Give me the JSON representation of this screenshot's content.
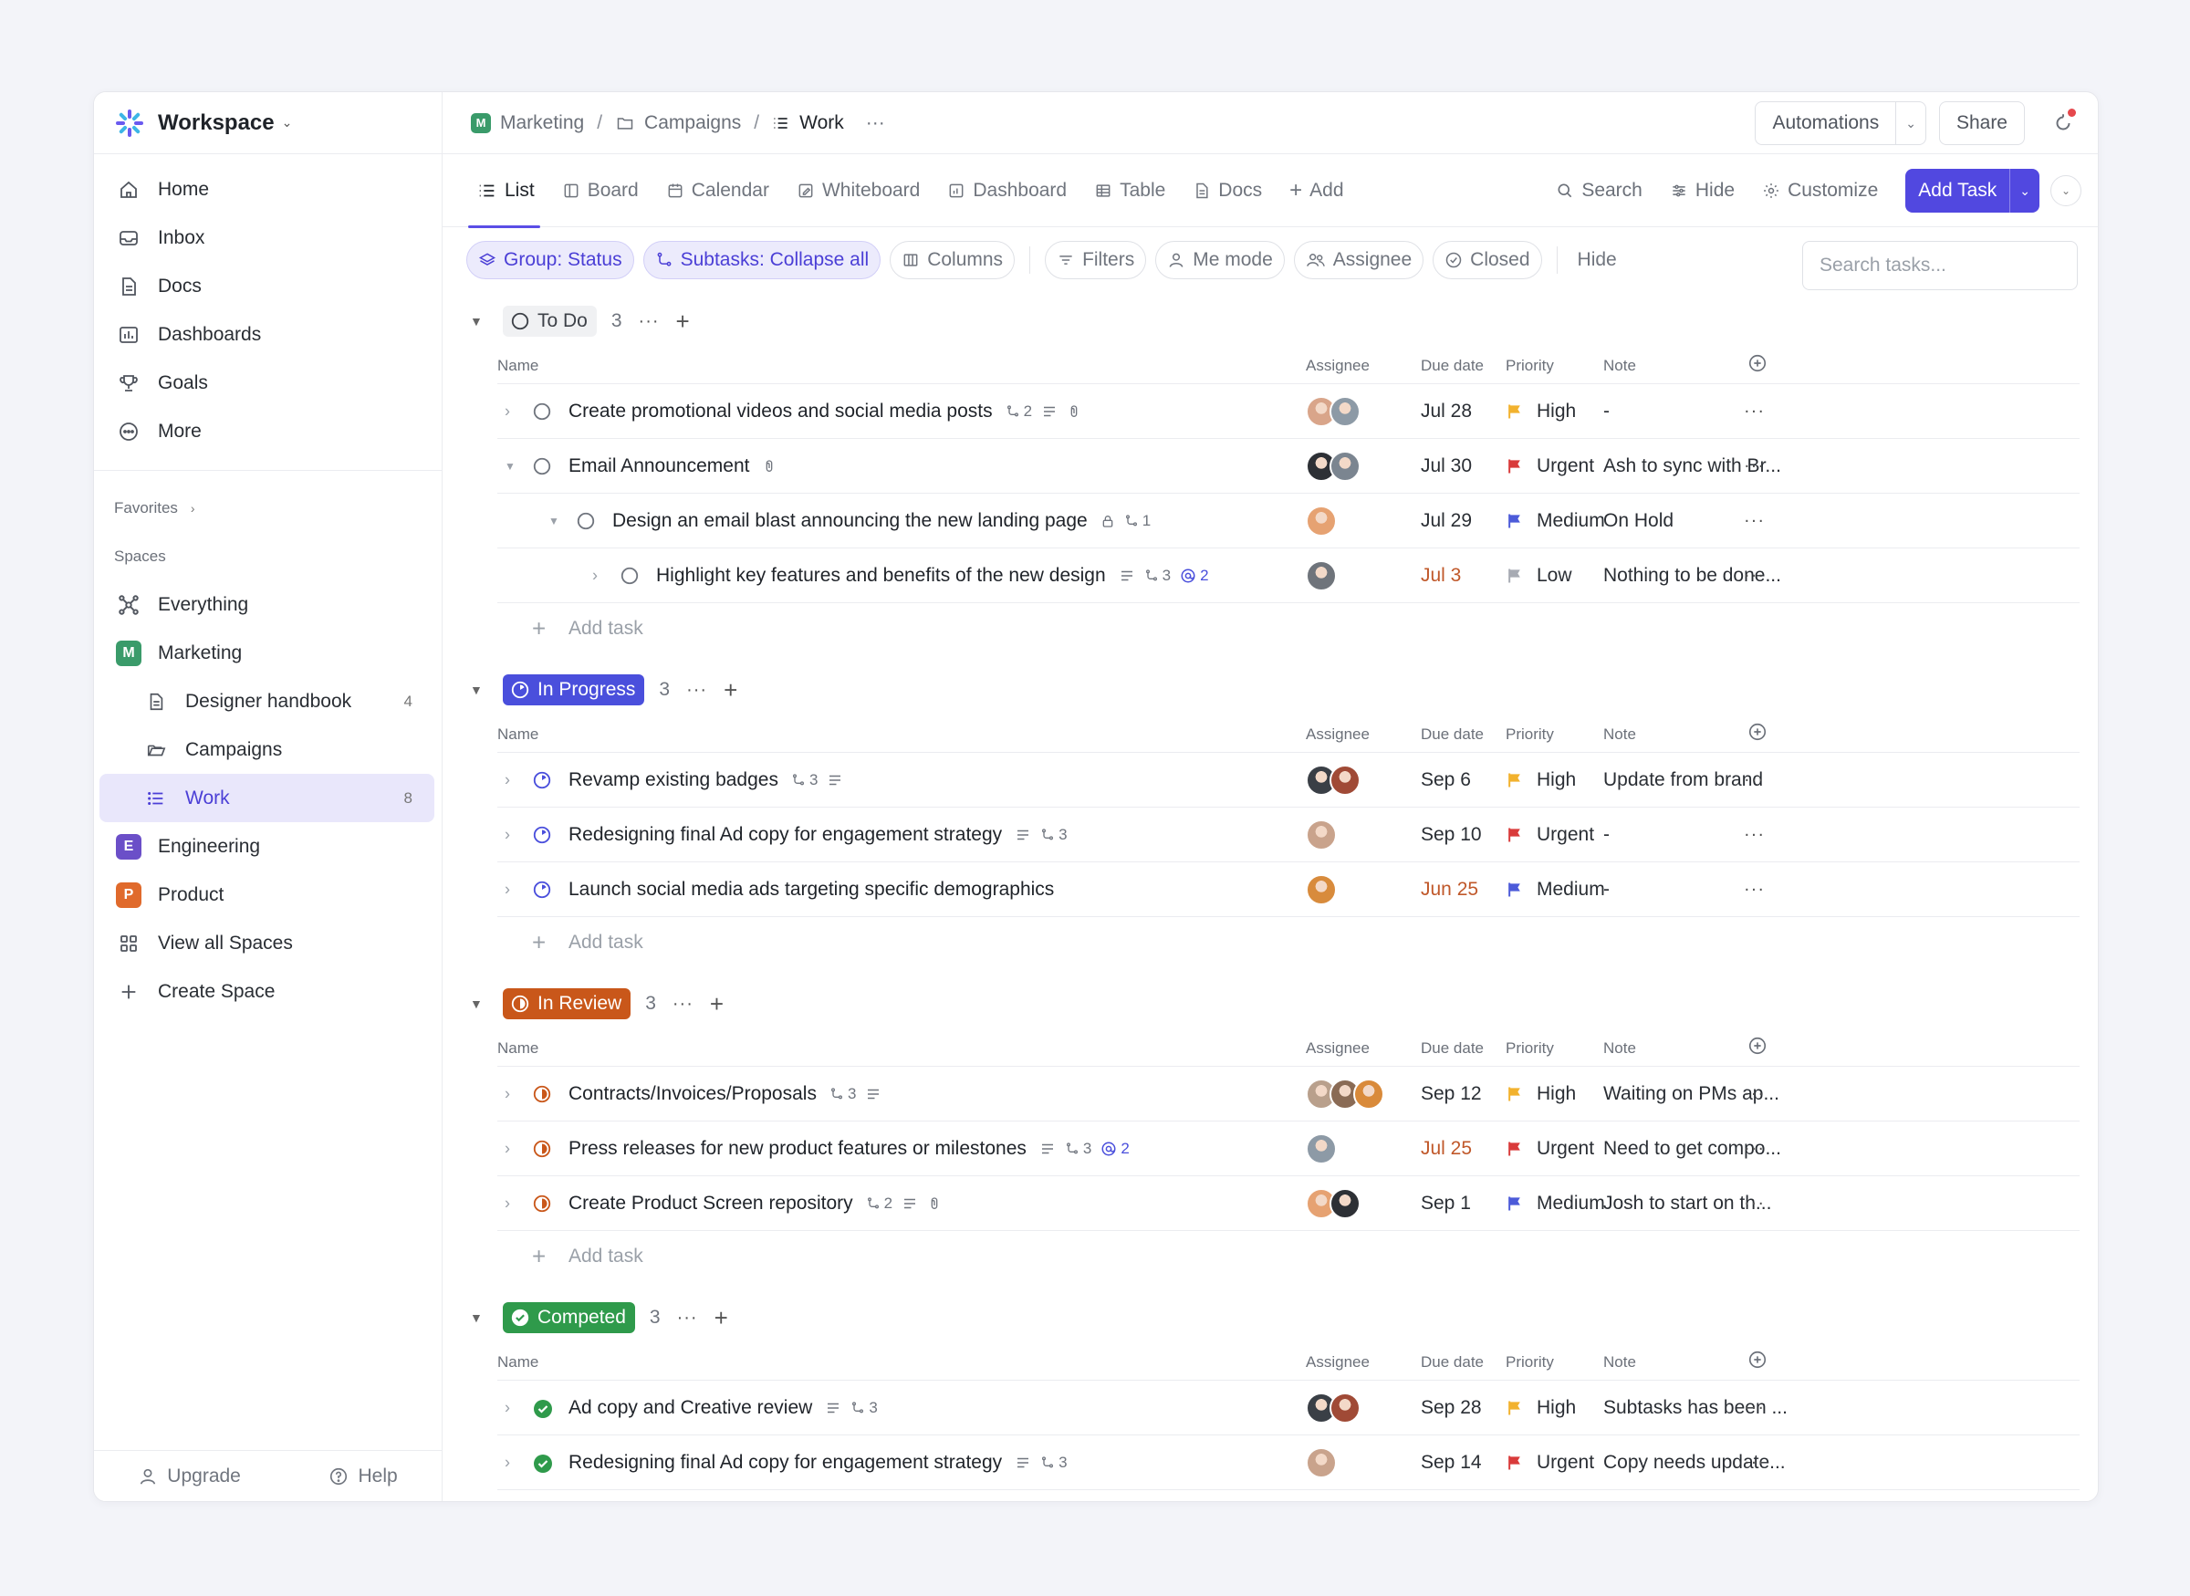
{
  "workspace": {
    "name": "Workspace"
  },
  "sidebar": {
    "nav": [
      {
        "label": "Home",
        "icon": "home-icon"
      },
      {
        "label": "Inbox",
        "icon": "inbox-icon"
      },
      {
        "label": "Docs",
        "icon": "docs-icon"
      },
      {
        "label": "Dashboards",
        "icon": "dashboards-icon"
      },
      {
        "label": "Goals",
        "icon": "trophy-icon"
      },
      {
        "label": "More",
        "icon": "more-icon"
      }
    ],
    "favorites_label": "Favorites",
    "spaces_label": "Spaces",
    "spaces": {
      "everything": "Everything",
      "marketing": {
        "label": "Marketing",
        "badge": "M",
        "color": "#3a9b6a"
      },
      "designer_handbook": {
        "label": "Designer handbook",
        "count": "4"
      },
      "campaigns": {
        "label": "Campaigns"
      },
      "work": {
        "label": "Work",
        "count": "8"
      },
      "engineering": {
        "label": "Engineering",
        "badge": "E",
        "color": "#6b4fc8"
      },
      "product": {
        "label": "Product",
        "badge": "P",
        "color": "#e06a2c"
      },
      "view_all": "View all Spaces",
      "create": "Create Space"
    },
    "footer": {
      "upgrade": "Upgrade",
      "help": "Help"
    }
  },
  "breadcrumb": {
    "space": "Marketing",
    "space_badge": "M",
    "folder": "Campaigns",
    "list": "Work",
    "more": "···"
  },
  "topbar": {
    "automations": "Automations",
    "share": "Share"
  },
  "views": {
    "tabs": [
      "List",
      "Board",
      "Calendar",
      "Whiteboard",
      "Dashboard",
      "Table",
      "Docs"
    ],
    "add": "Add",
    "search": "Search",
    "hide": "Hide",
    "customize": "Customize",
    "add_task": "Add Task"
  },
  "filters": {
    "group": "Group: Status",
    "subtasks": "Subtasks: Collapse all",
    "columns": "Columns",
    "filters": "Filters",
    "me_mode": "Me mode",
    "assignee": "Assignee",
    "closed": "Closed",
    "hide": "Hide",
    "search_placeholder": "Search tasks..."
  },
  "columns": {
    "name": "Name",
    "assignee": "Assignee",
    "due": "Due date",
    "priority": "Priority",
    "note": "Note"
  },
  "add_task_label": "Add task",
  "priority_colors": {
    "High": "#f2b22e",
    "Urgent": "#d93b3b",
    "Medium": "#4c5bd9",
    "Low": "#a7abb3"
  },
  "groups": [
    {
      "status": "To Do",
      "kind": "todo",
      "count": "3",
      "rows": [
        {
          "name": "Create promotional videos and social media posts",
          "indent": 0,
          "caret": "right",
          "meta": {
            "subtasks": "2",
            "desc": true,
            "attach": true
          },
          "assignees": [
            "#d9a58a",
            "#8d9aa6"
          ],
          "due": "Jul 28",
          "late": false,
          "priority": "High",
          "note": "-"
        },
        {
          "name": "Email Announcement",
          "indent": 0,
          "caret": "down",
          "meta": {
            "attach": true
          },
          "assignees": [
            "#2d3035",
            "#7b8590"
          ],
          "due": "Jul 30",
          "late": false,
          "priority": "Urgent",
          "note": "Ash to sync with Br..."
        },
        {
          "name": "Design an email blast announcing the new landing page",
          "indent": 1,
          "caret": "down",
          "meta": {
            "lock": true,
            "subtasks": "1"
          },
          "assignees": [
            "#e6a272"
          ],
          "due": "Jul 29",
          "late": false,
          "priority": "Medium",
          "note": "On Hold"
        },
        {
          "name": "Highlight key features and benefits of the new design",
          "indent": 2,
          "caret": "right",
          "meta": {
            "desc": true,
            "subtasks": "3",
            "mentions": "2"
          },
          "assignees": [
            "#6f747b"
          ],
          "due": "Jul 3",
          "late": true,
          "priority": "Low",
          "note": "Nothing to be done..."
        }
      ]
    },
    {
      "status": "In Progress",
      "kind": "prog",
      "count": "3",
      "rows": [
        {
          "name": "Revamp existing badges",
          "indent": 0,
          "caret": "right",
          "meta": {
            "subtasks": "3",
            "desc": true
          },
          "assignees": [
            "#3a3f46",
            "#a04a36"
          ],
          "due": "Sep 6",
          "late": false,
          "priority": "High",
          "note": "Update from brand"
        },
        {
          "name": "Redesigning final Ad copy for engagement strategy",
          "indent": 0,
          "caret": "right",
          "meta": {
            "desc": true,
            "subtasks": "3"
          },
          "assignees": [
            "#c9a38c"
          ],
          "due": "Sep 10",
          "late": false,
          "priority": "Urgent",
          "note": "-"
        },
        {
          "name": "Launch social media ads targeting specific demographics",
          "indent": 0,
          "caret": "right",
          "meta": {},
          "assignees": [
            "#d88b3c"
          ],
          "due": "Jun 25",
          "late": true,
          "priority": "Medium",
          "note": "-"
        }
      ]
    },
    {
      "status": "In Review",
      "kind": "rev",
      "count": "3",
      "rows": [
        {
          "name": "Contracts/Invoices/Proposals",
          "indent": 0,
          "caret": "right",
          "meta": {
            "subtasks": "3",
            "desc": true
          },
          "assignees": [
            "#b9a08c",
            "#8a6b55",
            "#d98a3a"
          ],
          "due": "Sep 12",
          "late": false,
          "priority": "High",
          "note": "Waiting on PMs ap..."
        },
        {
          "name": "Press releases for new product features or milestones",
          "indent": 0,
          "caret": "right",
          "meta": {
            "desc": true,
            "subtasks": "3",
            "mentions": "2"
          },
          "assignees": [
            "#8d9aa6"
          ],
          "due": "Jul 25",
          "late": true,
          "priority": "Urgent",
          "note": "Need to get compo..."
        },
        {
          "name": "Create Product Screen repository",
          "indent": 0,
          "caret": "right",
          "meta": {
            "subtasks": "2",
            "desc": true,
            "attach": true
          },
          "assignees": [
            "#e6a272",
            "#2d3035"
          ],
          "due": "Sep 1",
          "late": false,
          "priority": "Medium",
          "note": "Josh to start on th..."
        }
      ]
    },
    {
      "status": "Competed",
      "kind": "done",
      "count": "3",
      "rows": [
        {
          "name": "Ad copy and Creative review",
          "indent": 0,
          "caret": "right",
          "meta": {
            "desc": true,
            "subtasks": "3"
          },
          "assignees": [
            "#3a3f46",
            "#a04a36"
          ],
          "due": "Sep 28",
          "late": false,
          "priority": "High",
          "note": "Subtasks has been ..."
        },
        {
          "name": "Redesigning final Ad copy for engagement strategy",
          "indent": 0,
          "caret": "right",
          "meta": {
            "desc": true,
            "subtasks": "3"
          },
          "assignees": [
            "#c9a38c"
          ],
          "due": "Sep 14",
          "late": false,
          "priority": "Urgent",
          "note": "Copy needs update..."
        }
      ]
    }
  ]
}
